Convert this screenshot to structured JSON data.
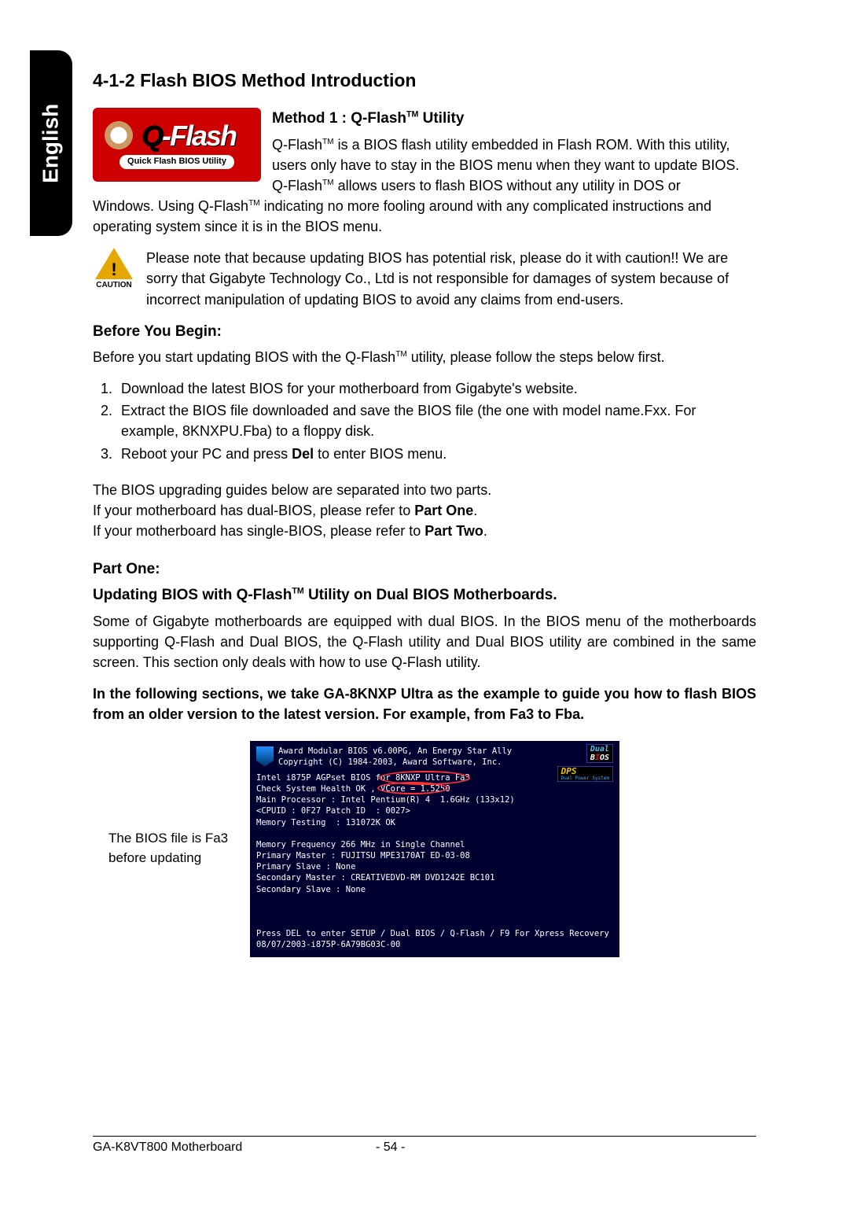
{
  "side_tab": "English",
  "section_heading": "4-1-2   Flash BIOS Method Introduction",
  "qflash_logo": {
    "big_prefix": "Q",
    "big_rest": "-Flash",
    "sub": "Quick Flash BIOS Utility"
  },
  "method1": {
    "heading_pre": "Method 1 : Q-Flash",
    "heading_post": " Utility",
    "p1a": "Q-Flash",
    "p1b": " is a BIOS flash utility embedded in Flash ROM. With this utility, users only have to stay in the BIOS menu when they want to update BIOS. Q-Flash",
    "p1c": " allows users to flash BIOS without any utility in DOS or",
    "p2a": "Windows. Using Q-Flash",
    "p2b": " indicating no more fooling around with any complicated instructions and operating system since it is in the BIOS menu."
  },
  "caution": {
    "label": "CAUTION",
    "text": "Please note that because updating BIOS has potential risk, please do it with caution!! We are sorry that Gigabyte Technology Co., Ltd is not responsible for damages of system because of incorrect manipulation of updating BIOS to avoid any claims from end-users."
  },
  "before": {
    "heading": "Before You Begin:",
    "intro_a": "Before you start updating BIOS with the Q-Flash",
    "intro_b": " utility, please follow the steps below first.",
    "steps": [
      "Download the latest BIOS for your motherboard from Gigabyte's website.",
      "Extract the BIOS file downloaded and save the BIOS file (the one with model name.Fxx. For example, 8KNXPU.Fba) to a floppy disk.",
      "Reboot your PC and press Del to enter BIOS menu."
    ]
  },
  "guides": {
    "l1": "The BIOS upgrading guides below are separated into two parts.",
    "l2a": "If your motherboard has dual-BIOS, please refer to ",
    "l2b": "Part One",
    "l2c": ".",
    "l3a": "If your motherboard has single-BIOS, please refer to ",
    "l3b": "Part Two",
    "l3c": "."
  },
  "part_one": {
    "heading": "Part One:",
    "sub_a": "Updating BIOS with Q-Flash",
    "sub_b": " Utility on Dual BIOS Motherboards.",
    "p1": "Some of Gigabyte motherboards are equipped with dual BIOS. In the BIOS menu of the motherboards supporting Q-Flash and Dual BIOS, the Q-Flash utility and Dual BIOS utility are combined in the same screen. This section only deals with how to use Q-Flash utility.",
    "p2": "In the following sections, we take GA-8KNXP Ultra as the example to guide you how to flash BIOS from an older version to the latest version. For example, from Fa3 to Fba."
  },
  "bios_note": "The BIOS file is Fa3 before updating",
  "bios_screen": {
    "hdr1": "Award Modular BIOS v6.00PG, An Energy Star Ally",
    "hdr2": "Copyright (C) 1984-2003, Award Software, Inc.",
    "badge_dual": "Dual",
    "badge_bios_b": "B",
    "badge_bios_i": "I",
    "badge_bios_o": "O",
    "badge_bios_s": "S",
    "badge_dps": "DPS",
    "badge_dps_tag": "Dual Power System",
    "l1": "Intel i875P AGPset BIOS for 8KNXP Ultra Fa3",
    "l2": "Check System Health OK , VCore = 1.5250",
    "l3": "Main Processor : Intel Pentium(R) 4  1.6GHz (133x12)",
    "l4": "<CPUID : 0F27 Patch ID  : 0027>",
    "l5": "Memory Testing  : 131072K OK",
    "l6": "Memory Frequency 266 MHz in Single Channel",
    "l7": "Primary Master : FUJITSU MPE3170AT ED-03-08",
    "l8": "Primary Slave : None",
    "l9": "Secondary Master : CREATIVEDVD-RM DVD1242E BC101",
    "l10": "Secondary Slave : None",
    "l11": "Press DEL to enter SETUP / Dual BIOS / Q-Flash / F9 For Xpress Recovery",
    "l12": "08/07/2003-i875P-6A79BG03C-00"
  },
  "footer": {
    "left": "GA-K8VT800 Motherboard",
    "page": "- 54 -"
  },
  "tm": "TM"
}
